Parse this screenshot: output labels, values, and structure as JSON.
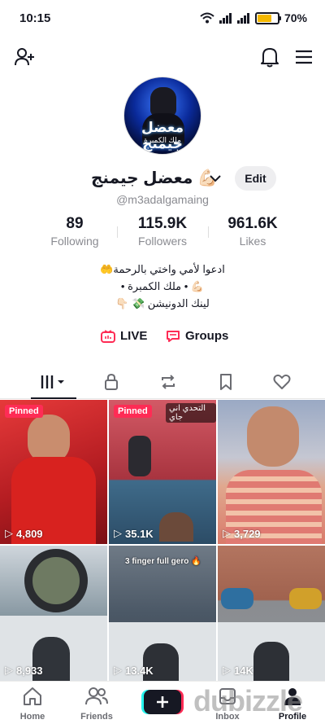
{
  "status": {
    "time": "10:15",
    "battery": "70%",
    "battery_level": 0.7
  },
  "profile": {
    "avatar_text_main": "معضل جيمنج",
    "avatar_text_sub": "ملك الكمبرة",
    "display_name": "معضل جيمنج 💪🏻",
    "handle": "@m3adalgamaing",
    "edit_label": "Edit"
  },
  "stats": {
    "following_count": "89",
    "following_label": "Following",
    "followers_count": "115.9K",
    "followers_label": "Followers",
    "likes_count": "961.6K",
    "likes_label": "Likes"
  },
  "bio": {
    "line1": "ادعوا لأمي واختي بالرحمة🤲",
    "line2": "💪🏻 • ملك الكمبرة •",
    "line3": "لينك الدونيشن 💸 👇🏻"
  },
  "links": {
    "live_label": "LIVE",
    "groups_label": "Groups"
  },
  "tabs": [
    {
      "icon": "grid-icon"
    },
    {
      "icon": "lock-icon"
    },
    {
      "icon": "repost-icon"
    },
    {
      "icon": "bookmark-icon"
    },
    {
      "icon": "heart-icon"
    }
  ],
  "videos": [
    {
      "pinned": "Pinned",
      "views": "4,809",
      "bg": "#c81d26"
    },
    {
      "pinned": "Pinned",
      "views": "35.1K",
      "bg": "#b84148",
      "caption": "التحدي اني جاي"
    },
    {
      "views": "3,729",
      "bg": "#d9a08a"
    },
    {
      "views": "8,933",
      "bg": "#4e5a62"
    },
    {
      "views": "13.4K",
      "bg": "#3c4654",
      "caption": "3 finger full gero 🔥"
    },
    {
      "views": "14K",
      "bg": "#8b6d5a"
    }
  ],
  "nav": {
    "home_label": "Home",
    "friends_label": "Friends",
    "inbox_label": "Inbox",
    "profile_label": "Profile"
  },
  "watermark": "dubizzle",
  "colors": {
    "accent": "#fe2c55",
    "cyan": "#25f4ee",
    "text": "#161823",
    "muted": "#8a8b91"
  }
}
